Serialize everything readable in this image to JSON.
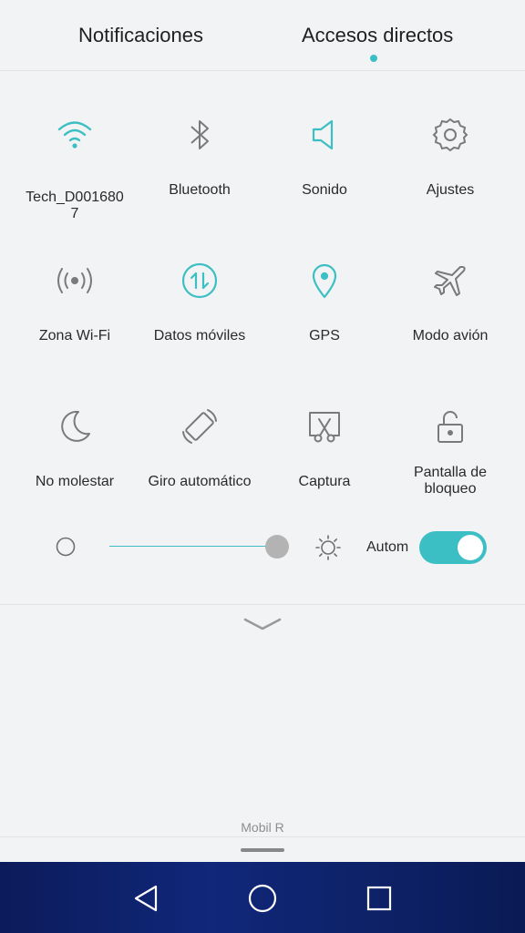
{
  "tabs": [
    {
      "label": "Notificaciones",
      "active": false
    },
    {
      "label": "Accesos directos",
      "active": true
    }
  ],
  "accent_color": "#3bbfc4",
  "tiles": [
    {
      "label": "Tech_D001680\n7",
      "icon": "wifi-icon",
      "active": true
    },
    {
      "label": "Bluetooth",
      "icon": "bluetooth-icon",
      "active": false
    },
    {
      "label": "Sonido",
      "icon": "speaker-icon",
      "active": true
    },
    {
      "label": "Ajustes",
      "icon": "gear-icon",
      "active": false
    },
    {
      "label": "Zona Wi-Fi",
      "icon": "hotspot-icon",
      "active": false
    },
    {
      "label": "Datos móviles",
      "icon": "mobile-data-icon",
      "active": true
    },
    {
      "label": "GPS",
      "icon": "location-pin-icon",
      "active": true
    },
    {
      "label": "Modo avión",
      "icon": "airplane-icon",
      "active": false
    },
    {
      "label": "No molestar",
      "icon": "moon-icon",
      "active": false
    },
    {
      "label": "Giro automático",
      "icon": "auto-rotate-icon",
      "active": false
    },
    {
      "label": "Captura",
      "icon": "screenshot-icon",
      "active": false
    },
    {
      "label": "Pantalla de bloqueo",
      "icon": "lock-icon",
      "active": false
    }
  ],
  "brightness": {
    "level": 0.96,
    "auto_label": "Autom",
    "auto_enabled": true
  },
  "carrier": "Mobil R",
  "navbar": {
    "buttons": [
      "back-icon",
      "home-icon",
      "recents-icon"
    ]
  }
}
